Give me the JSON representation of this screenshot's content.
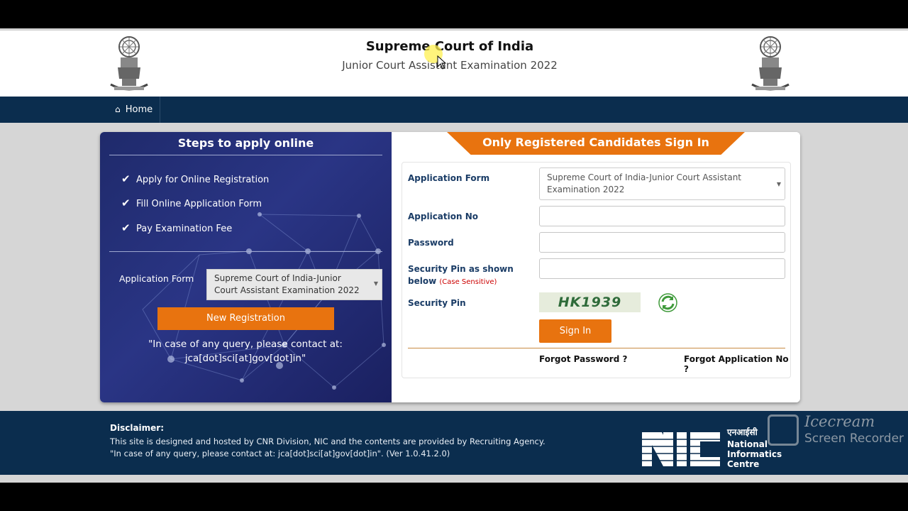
{
  "header": {
    "title": "Supreme Court of India",
    "subtitle": "Junior Court Assistant Examination 2022"
  },
  "nav": {
    "home_label": "Home"
  },
  "left_panel": {
    "title": "Steps to apply online",
    "steps": [
      "Apply for Online Registration",
      "Fill Online Application Form",
      "Pay Examination Fee"
    ],
    "application_form_label": "Application Form",
    "application_form_value": "Supreme Court of India-Junior Court Assistant Examination 2022",
    "new_registration_label": "New Registration",
    "query_text": "\"In case of any query, please contact at: jca[dot]sci[at]gov[dot]in\""
  },
  "sign_in": {
    "banner": "Only Registered Candidates Sign In",
    "application_form_label": "Application Form",
    "application_form_value": "Supreme Court of India-Junior Court Assistant Examination 2022",
    "application_no_label": "Application No",
    "password_label": "Password",
    "security_pin_shown_label": "Security Pin as shown below",
    "case_sensitive": "(Case Sensitive)",
    "security_pin_label": "Security Pin",
    "captcha_text": "HK1939",
    "sign_in_label": "Sign In",
    "forgot_password": "Forgot Password ?",
    "forgot_application_no": "Forgot Application No ?"
  },
  "footer": {
    "disclaimer_heading": "Disclaimer:",
    "line1": "This site is designed and hosted by CNR Division, NIC and the contents are provided by Recruiting Agency.",
    "line2": "\"In case of any query, please contact at: jca[dot]sci[at]gov[dot]in\". (Ver 1.0.41.2.0)",
    "nic_hindi": "एनआईसी",
    "nic_line1": "National",
    "nic_line2": "Informatics",
    "nic_line3": "Centre"
  },
  "watermark": {
    "line1": "Icecream",
    "line2": "Screen Recorder"
  },
  "colors": {
    "navy": "#0b2d4e",
    "orange": "#e8730f",
    "panel_blue": "#2a3585"
  }
}
